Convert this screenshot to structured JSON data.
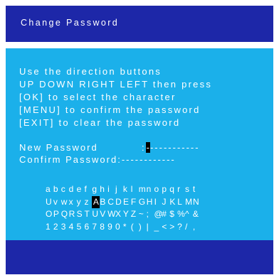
{
  "header": {
    "title": "Change Password"
  },
  "instructions": [
    "Use the direction buttons",
    "UP DOWN RIGHT LEFT then press",
    "[OK] to select the character",
    "[MENU] to confirm the password",
    "[EXIT] to clear the password"
  ],
  "password": {
    "new_label": "New Password",
    "new_sep": ":",
    "new_cursor": "-",
    "new_dashes": "-----------",
    "confirm_label": "Confirm Password:",
    "confirm_dashes": "------------"
  },
  "charset": {
    "rows": [
      "abcdefghijklmnopqrst",
      "UvwxyzABCDEFGHIJKLMN",
      "OPQRSTUVWXYZ~;@#$%^&",
      "1234567890*()|_<>?/,"
    ],
    "selected": {
      "row": 1,
      "col": 6
    }
  },
  "colors": {
    "title_bar": "#1d27a8",
    "panel": "#1bb0ea",
    "bottom_bar": "#1d27a8",
    "text": "#ffffff",
    "highlight": "#000000"
  }
}
